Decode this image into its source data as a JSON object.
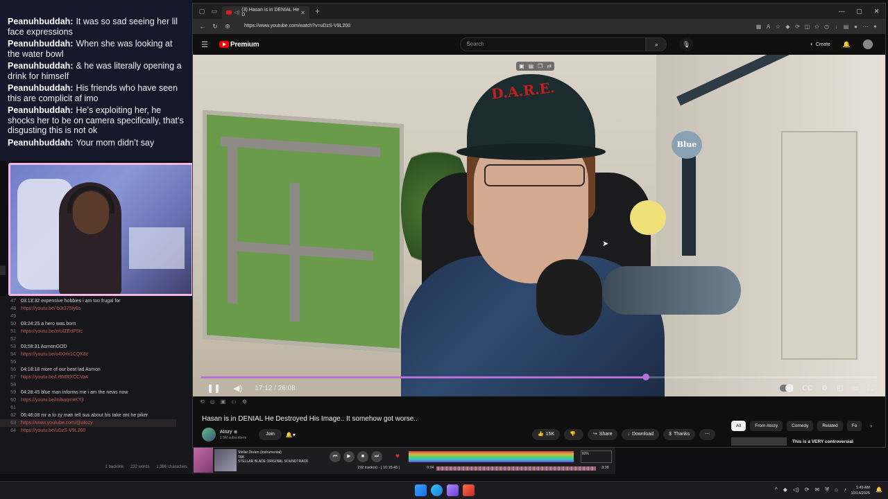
{
  "chat": {
    "messages": [
      {
        "user": "Peanuhbuddah:",
        "text": "It was so sad seeing her lil face expressions"
      },
      {
        "user": "Peanuhbuddah:",
        "text": "When she was looking at the water bowl"
      },
      {
        "user": "Peanuhbuddah:",
        "text": "& he was literally opening a drink for himself"
      },
      {
        "user": "Peanuhbuddah:",
        "text": "His friends who have seen this are complicit af imo"
      },
      {
        "user": "Peanuhbuddah:",
        "text": "He’s exploiting her, he shocks her to be on camera specifically, that’s disgusting this is not ok"
      },
      {
        "user": "Peanuhbuddah:",
        "text": "Your mom didn’t say"
      }
    ]
  },
  "notes": {
    "rows": [
      {
        "ln": "47",
        "text": "03:13:32 expensive hobbies i am too frugal for",
        "link": false
      },
      {
        "ln": "48",
        "text": "https://youtu.be/-b3t375Iy6s",
        "link": true
      },
      {
        "ln": "49",
        "text": "",
        "link": false
      },
      {
        "ln": "50",
        "text": "03:24:25 a hero was born",
        "link": false
      },
      {
        "ln": "51",
        "text": "https://youtu.be/zrUlZEdP5tc",
        "link": true
      },
      {
        "ln": "52",
        "text": "",
        "link": false
      },
      {
        "ln": "53",
        "text": "03:58:31  AsmonGOD",
        "link": false
      },
      {
        "ln": "54",
        "text": "https://youtu.be/o4XHx1CQK8c",
        "link": true
      },
      {
        "ln": "55",
        "text": "",
        "link": false
      },
      {
        "ln": "56",
        "text": "04:18:18 more of our best lad Asmon",
        "link": false
      },
      {
        "ln": "57",
        "text": "https://youtu.be/Lt9MRXCCVa4",
        "link": true
      },
      {
        "ln": "58",
        "text": "",
        "link": false
      },
      {
        "ln": "59",
        "text": "04:28:45  blue man informs me i am the news now",
        "link": false
      },
      {
        "ln": "60",
        "text": "https://youtu.be/mibaqmvKYjI",
        "link": true
      },
      {
        "ln": "61",
        "text": "",
        "link": false
      },
      {
        "ln": "62",
        "text": "06:46:08  mr a to zy man tell sus about his take ont he piker",
        "link": false
      },
      {
        "ln": "63",
        "text": "https://www.youtube.com/@atozy",
        "link": true,
        "highlight": true
      },
      {
        "ln": "64",
        "text": "https://youtu.be/uDzS-V9L200",
        "link": true
      }
    ],
    "status": {
      "backlink": "1 backlink",
      "words": "232 words",
      "chars": "1,386 characters"
    }
  },
  "browser": {
    "tab_title": "(3) Hasan is in DENIAL He D",
    "url": "https://www.youtube.com/watch?v=uDzS-V9L200",
    "youtube": {
      "logo_word": "Premium",
      "search_placeholder": "Search",
      "create_label": "Create"
    },
    "video": {
      "time_current": "17:12",
      "time_total": "26:08",
      "time_display": "17:12 / 26:08",
      "progress_fraction": 0.658,
      "cap_text": "D.A.R.E.",
      "mic_brand": "Blue"
    },
    "title": "Hasan is in DENIAL He Destroyed His Image.. It somehow got worse..",
    "channel": {
      "name": "Atozy",
      "subs": "1.9M subscribers",
      "join": "Join"
    },
    "actions": {
      "likes": "15K",
      "share": "Share",
      "download": "Download",
      "thanks": "Thanks"
    },
    "chips": [
      "All",
      "From Atozy",
      "Comedy",
      "Related",
      "Fo"
    ],
    "rec_title": "This is a VERY controversial"
  },
  "player": {
    "track_title": "Stellar Dream (Instrumental)",
    "artist": "TAK",
    "album": "STELLAR BLADE ORIGINAL SOUNDTRACK",
    "tracks": "192 track(s) · [ 10:15:45 ]",
    "position": "0:04",
    "length": "3:38",
    "volume": "82%"
  },
  "taskbar": {
    "time": "1:49 AM",
    "date": "10/14/2025"
  },
  "colors": {
    "chat_bg": "#15172b",
    "webcam_border": "#f3b6e6",
    "progress": "#b86fd6",
    "youtube_red": "#ff0000",
    "link": "#c05a54"
  }
}
